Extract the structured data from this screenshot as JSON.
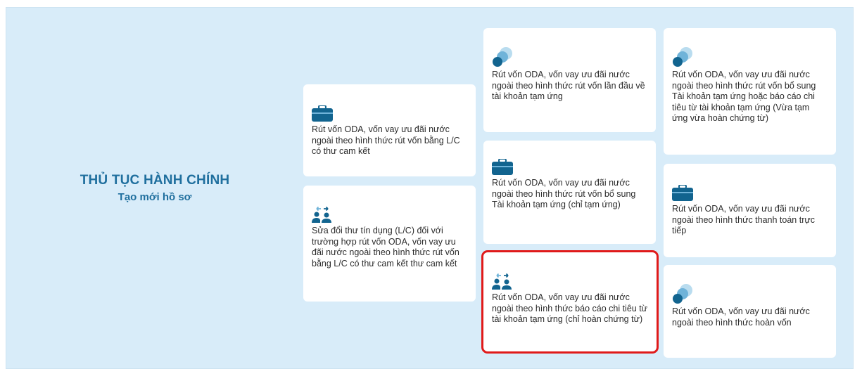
{
  "heading": {
    "title": "THỦ TỤC HÀNH CHÍNH",
    "subtitle": "Tạo mới hồ sơ"
  },
  "colors": {
    "background_panel": "#d8ecf9",
    "heading": "#1f6f9e",
    "icon_dark": "#12648f",
    "icon_light": "#6fb3d9",
    "selected_border": "#e01a1a"
  },
  "cards": [
    {
      "icon": "briefcase-icon",
      "text": "Rút vốn ODA, vốn vay ưu đãi nước ngoài theo hình thức rút vốn bằng L/C có thư cam kết"
    },
    {
      "icon": "people-exchange-icon",
      "text": "Sửa đổi thư tín dụng (L/C) đối với trường hợp rút vốn ODA, vốn vay ưu đãi nước ngoài theo hình thức rút vốn bằng L/C có thư cam kết thư cam kết"
    },
    {
      "icon": "circles-icon",
      "text": "Rút vốn ODA, vốn vay ưu đãi nước ngoài theo hình thức rút vốn lần đầu về tài khoản tạm ứng"
    },
    {
      "icon": "briefcase-icon",
      "text": "Rút vốn ODA, vốn vay ưu đãi nước ngoài theo hình thức rút vốn bổ sung Tài khoản tạm ứng (chỉ tạm ứng)"
    },
    {
      "icon": "people-exchange-icon",
      "text": "Rút vốn ODA, vốn vay ưu đãi nước ngoài theo hình thức báo cáo chi tiêu từ tài khoản tạm ứng (chỉ hoàn chứng từ)",
      "selected": true
    },
    {
      "icon": "circles-icon",
      "text": "Rút vốn ODA, vốn vay ưu đãi nước ngoài theo hình thức rút vốn bổ sung Tài khoản tạm ứng hoặc báo cáo chi tiêu từ tài khoản tạm ứng (Vừa tạm ứng vừa hoàn chứng từ)"
    },
    {
      "icon": "briefcase-icon",
      "text": "Rút vốn ODA, vốn vay ưu đãi nước ngoài theo hình thức thanh toán trực tiếp"
    },
    {
      "icon": "circles-icon",
      "text": "Rút vốn ODA, vốn vay ưu đãi nước ngoài theo hình thức hoàn vốn"
    }
  ]
}
